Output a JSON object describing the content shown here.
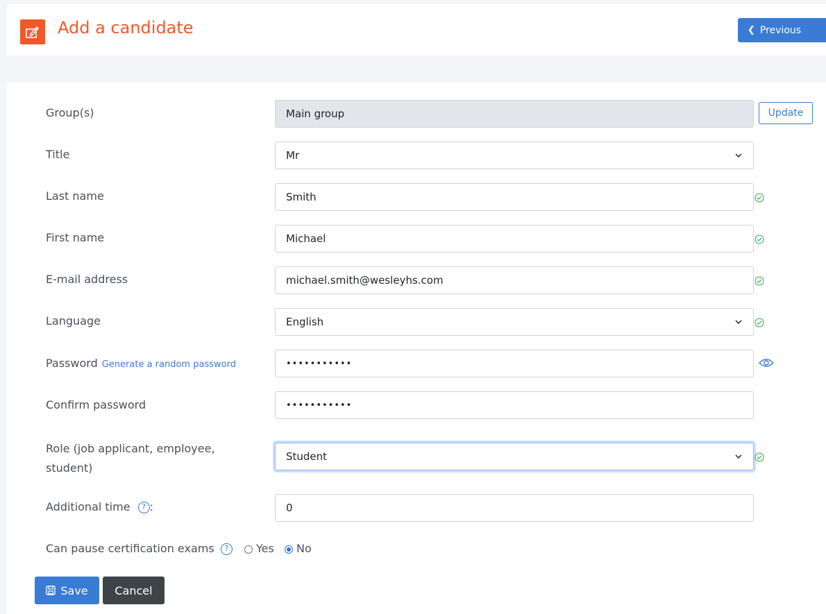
{
  "header": {
    "title": "Add a candidate",
    "icon": "edit-icon",
    "previous_label": "Previous",
    "accent_color": "#f1592a"
  },
  "form": {
    "groups": {
      "label": "Group(s)",
      "value": "Main group",
      "update_label": "Update"
    },
    "title": {
      "label": "Title",
      "value": "Mr"
    },
    "last_name": {
      "label": "Last name",
      "value": "Smith"
    },
    "first_name": {
      "label": "First name",
      "value": "Michael"
    },
    "email": {
      "label": "E-mail address",
      "value": "michael.smith@wesleyhs.com"
    },
    "language": {
      "label": "Language",
      "value": "English"
    },
    "password": {
      "label": "Password",
      "link": "Generate a random password",
      "masked": "•••••••••••"
    },
    "confirm_password": {
      "label": "Confirm password",
      "masked": "•••••••••••"
    },
    "role": {
      "label_line1": "Role (job applicant, employee,",
      "label_line2": "student)",
      "value": "Student"
    },
    "additional_time": {
      "label": "Additional time",
      "suffix": ":",
      "value": "0"
    },
    "can_pause": {
      "label": "Can pause certification exams",
      "yes": "Yes",
      "no": "No",
      "selected": "No"
    }
  },
  "actions": {
    "save_label": "Save",
    "cancel_label": "Cancel"
  },
  "colors": {
    "primary": "#3a7bd5",
    "valid": "#28a745",
    "dark_button": "#3f4448"
  }
}
